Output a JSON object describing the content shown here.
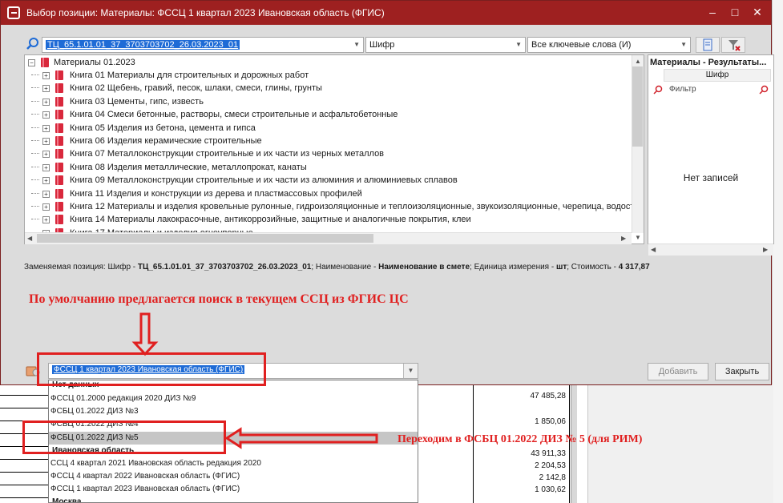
{
  "window": {
    "title": "Выбор позиции: Материалы: ФССЦ 1 квартал 2023 Ивановская область (ФГИС)",
    "minimize": "–",
    "maximize": "□",
    "close": "✕",
    "title_color": "#9e2020"
  },
  "toolbar": {
    "search_value": "ТЦ_65.1.01.01_37_3703703702_26.03.2023_01",
    "field_combo": "Шифр",
    "keywords_combo": "Все ключевые слова (И)"
  },
  "tree": {
    "root": "Материалы 01.2023",
    "items": [
      "Книга 01 Материалы для строительных и дорожных работ",
      "Книга 02 Щебень, гравий, песок, шлаки, смеси, глины, грунты",
      "Книга 03 Цементы, гипс, известь",
      "Книга 04 Смеси бетонные, растворы, смеси строительные и асфальтобетонные",
      "Книга 05 Изделия из бетона, цемента и гипса",
      "Книга 06 Изделия керамические строительные",
      "Книга 07 Металлоконструкции строительные и их части из черных металлов",
      "Книга 08 Изделия металлические, металлопрокат, канаты",
      "Книга 09 Металлоконструкции строительные и их части из алюминия и алюминиевых сплавов",
      "Книга 11 Изделия и конструкции из дерева и пластмассовых профилей",
      "Книга 12 Материалы и изделия кровельные рулонные, гидроизоляционные и теплоизоляционные, звукоизоляционные, черепица, водост",
      "Книга 14 Материалы лакокрасочные, антикоррозийные, защитные и аналогичные покрытия, клеи",
      "Книга 17 Материалы и изделия огнеупорные"
    ]
  },
  "results": {
    "title": "Материалы - Результаты...",
    "column": "Шифр",
    "filter_placeholder": "Фильтр",
    "empty": "Нет записей"
  },
  "info": {
    "prefix": "Заменяемая позиция: Шифр - ",
    "code": "ТЦ_65.1.01.01_37_3703703702_26.03.2023_01",
    "name_label": "; Наименование - ",
    "name": "Наименование в смете",
    "unit_label": "; Единица измерения - ",
    "unit": "шт",
    "cost_label": "; Стоимость - ",
    "cost": "4 317,87"
  },
  "annotations": {
    "top": "По умолчанию предлагается поиск в текущем ССЦ из ФГИС ЦС",
    "bottom": "Переходим в ФСБЦ 01.2022 ДИЗ № 5 (для РИМ)",
    "color": "#e02020"
  },
  "source": {
    "selected": "ФССЦ 1 квартал 2023 Ивановская область (ФГИС)",
    "add_button": "Добавить",
    "close_button": "Закрыть"
  },
  "dropdown": {
    "items": [
      {
        "label": "Нет данных",
        "group": true
      },
      {
        "label": "ФССЦ 01.2000 редакция 2020 ДИЗ №9"
      },
      {
        "label": "ФСБЦ 01.2022 ДИЗ №3"
      },
      {
        "label": "ФСБЦ 01.2022 ДИЗ №4"
      },
      {
        "label": "ФСБЦ 01.2022 ДИЗ №5",
        "selected": true
      },
      {
        "label": "Ивановская область",
        "group": true
      },
      {
        "label": "ССЦ 4 квартал 2021 Ивановская область редакция 2020"
      },
      {
        "label": "ФССЦ 4 квартал 2022 Ивановская область (ФГИС)"
      },
      {
        "label": "ФССЦ 1 квартал 2023 Ивановская область (ФГИС)"
      },
      {
        "label": "Москва",
        "group": true
      }
    ]
  },
  "background_numbers": [
    "47 485,28",
    "1 850,06",
    "43 911,33",
    "2 204,53",
    "2 142,8",
    "1 030,62"
  ]
}
